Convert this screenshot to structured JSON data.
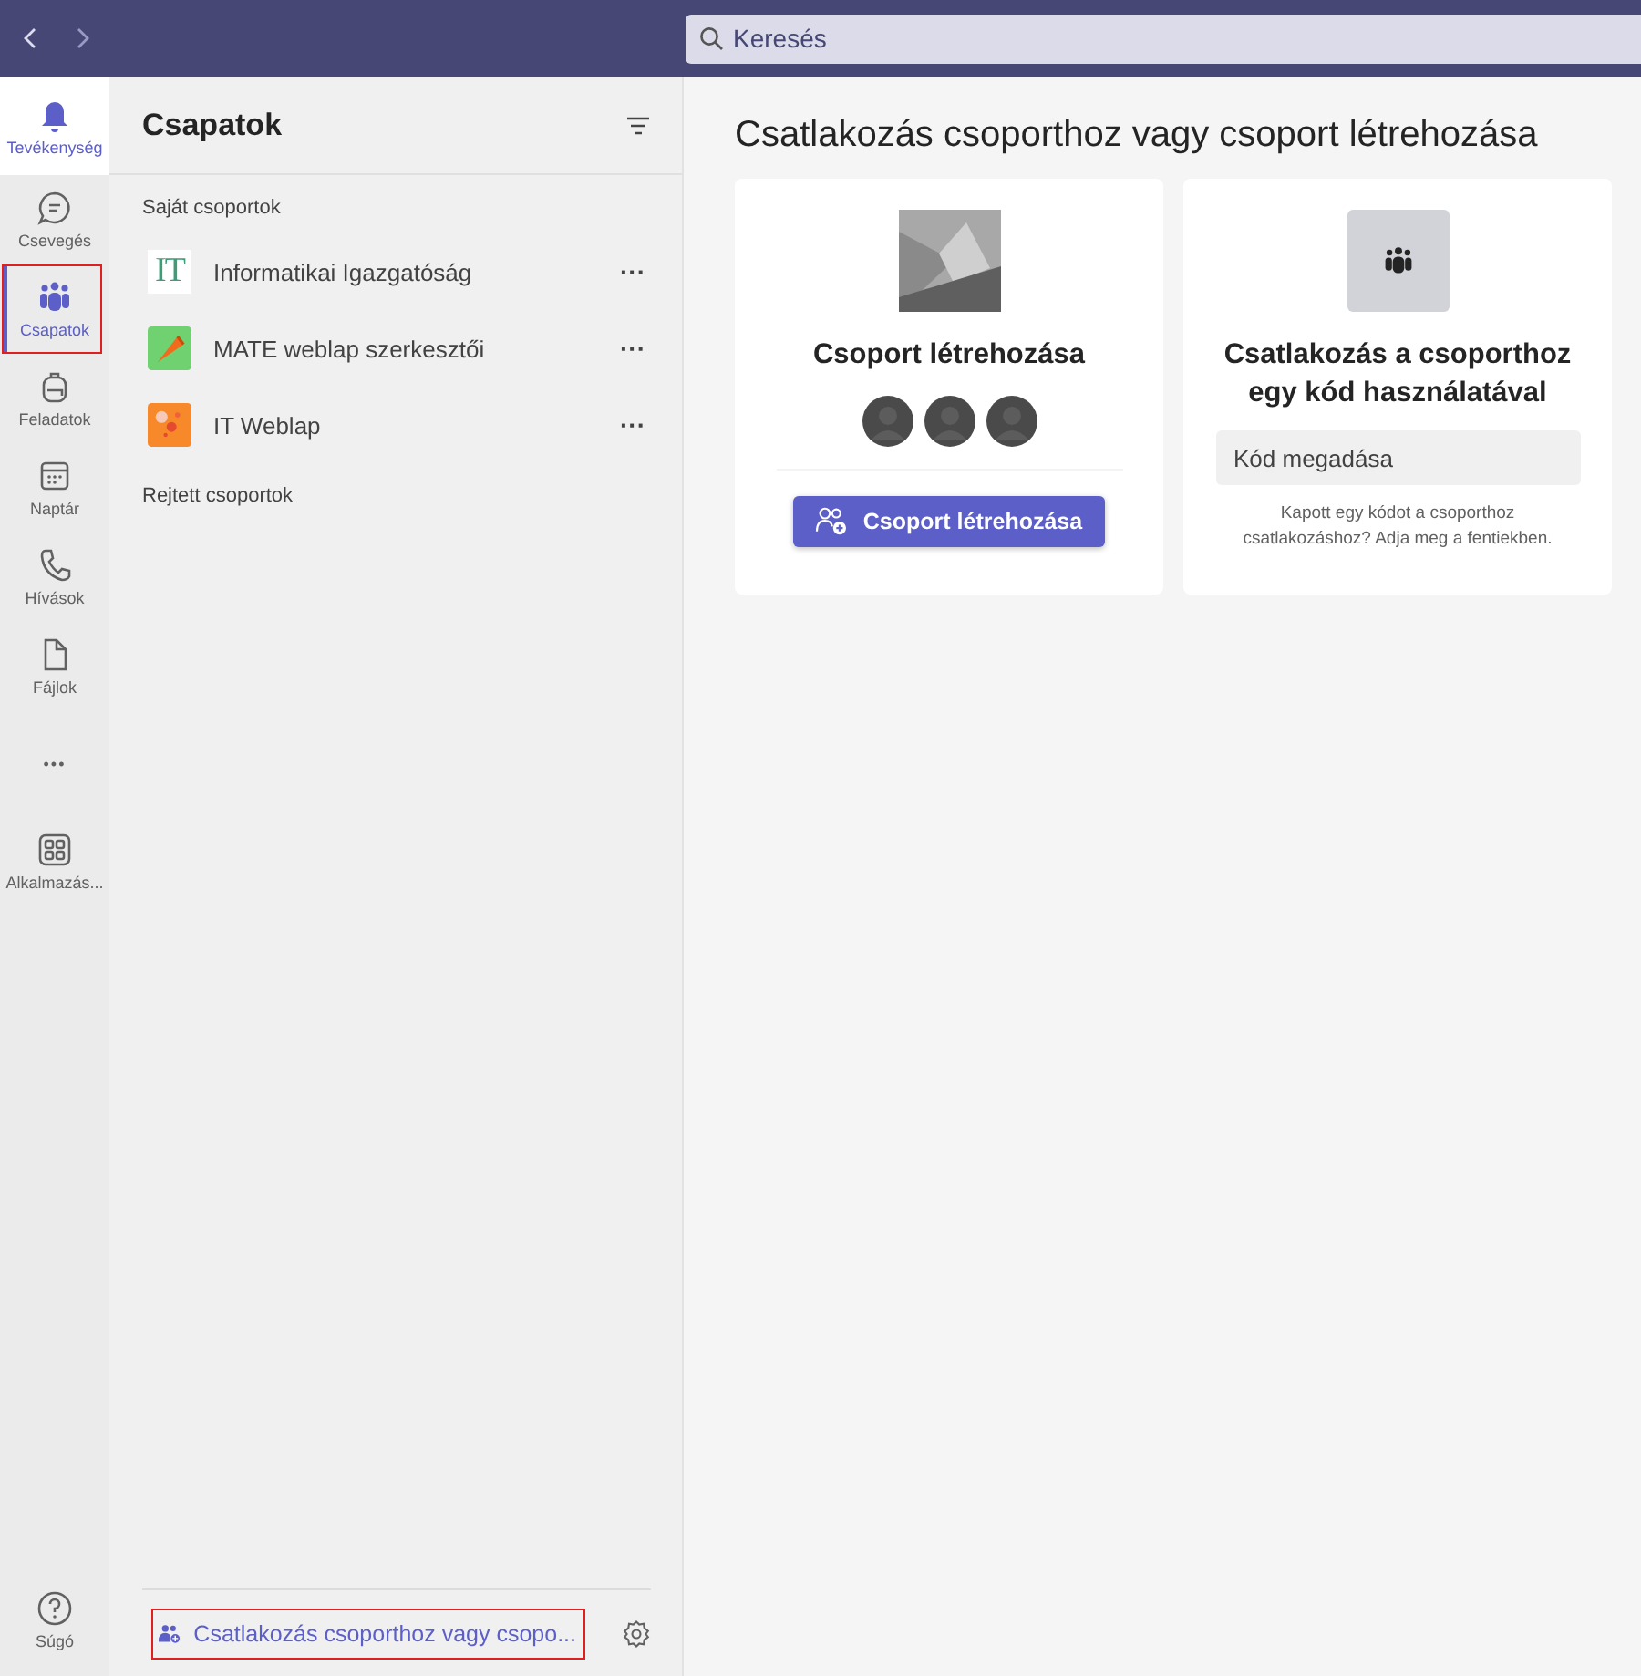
{
  "top_bar": {
    "search": {
      "placeholder": "Keresés"
    }
  },
  "rail": {
    "items": [
      {
        "kind": "bell",
        "label": "Tevékenység",
        "selected": false,
        "hover": true,
        "annotated": false
      },
      {
        "kind": "chat",
        "label": "Csevegés",
        "selected": false,
        "hover": false,
        "annotated": false
      },
      {
        "kind": "teams",
        "label": "Csapatok",
        "selected": true,
        "hover": false,
        "annotated": true
      },
      {
        "kind": "backpack",
        "label": "Feladatok",
        "selected": false,
        "hover": false,
        "annotated": false
      },
      {
        "kind": "calendar",
        "label": "Naptár",
        "selected": false,
        "hover": false,
        "annotated": false
      },
      {
        "kind": "phone",
        "label": "Hívások",
        "selected": false,
        "hover": false,
        "annotated": false
      },
      {
        "kind": "file",
        "label": "Fájlok",
        "selected": false,
        "hover": false,
        "annotated": false
      },
      {
        "kind": "more",
        "label": "•••",
        "selected": false,
        "hover": false,
        "annotated": false
      },
      {
        "kind": "apps",
        "label": "Alkalmazás...",
        "selected": false,
        "hover": false,
        "annotated": false
      }
    ],
    "help": {
      "label": "Súgó"
    }
  },
  "teams_panel": {
    "title": "Csapatok",
    "sections": [
      {
        "title": "Saját csoportok",
        "teams": [
          {
            "kind": "letters",
            "logo_text": "IT",
            "name": "Informatikai Igazgatóság",
            "more": "···"
          },
          {
            "kind": "megaphone",
            "name": "MATE weblap szerkesztői",
            "more": "···"
          },
          {
            "kind": "flowers",
            "name": "IT Weblap",
            "more": "···"
          }
        ]
      },
      {
        "title": "Rejtett csoportok"
      }
    ],
    "join_link": {
      "label": "Csatlakozás csoporthoz vagy csopo...",
      "annotated": true
    }
  },
  "main": {
    "title": "Csatlakozás csoporthoz vagy csoport létrehozása",
    "cards": [
      {
        "kind": "create",
        "title": "Csoport létrehozása",
        "button": "Csoport létrehozása"
      },
      {
        "kind": "join",
        "title": "Csatlakozás a csoporthoz egy kód használatával",
        "placeholder": "Kód megadása",
        "hint": "Kapott egy kódot a csoporthoz csatlakozáshoz? Adja meg a fentiekben."
      }
    ]
  }
}
